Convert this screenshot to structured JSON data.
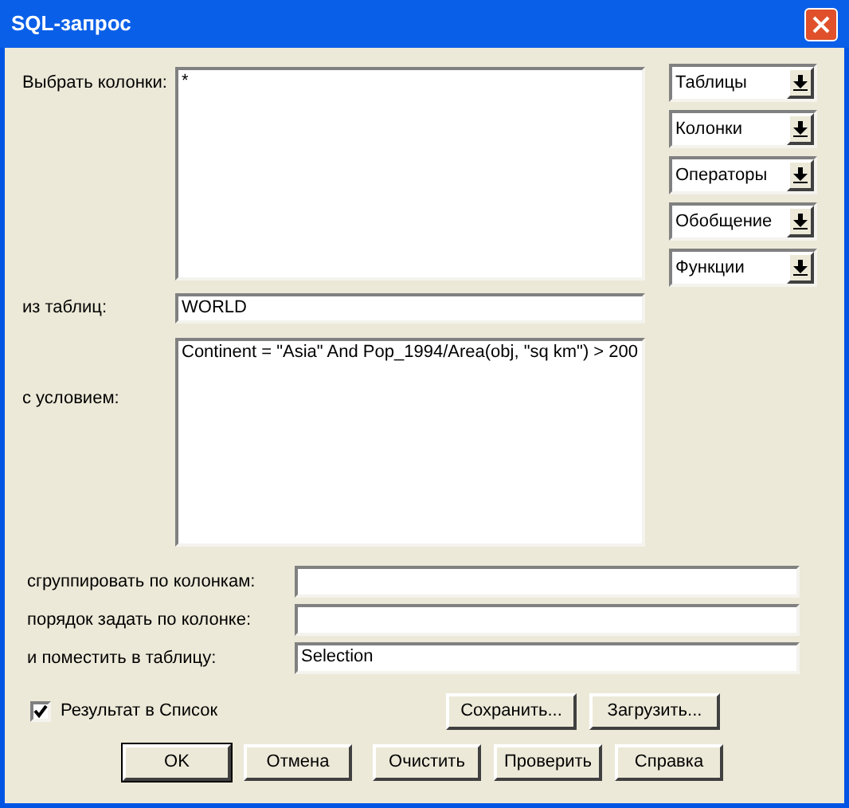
{
  "window": {
    "title": "SQL-запрос"
  },
  "select_columns": {
    "label": "Выбрать колонки:",
    "value": "*"
  },
  "dropdowns": [
    {
      "label": "Таблицы"
    },
    {
      "label": "Колонки"
    },
    {
      "label": "Операторы"
    },
    {
      "label": "Обобщение"
    },
    {
      "label": "Функции"
    }
  ],
  "from_tables": {
    "label": "из таблиц:",
    "value": "WORLD"
  },
  "condition": {
    "label": "с условием:",
    "value": "Continent = \"Asia\" And Pop_1994/Area(obj, \"sq km\") > 200"
  },
  "lower_fields": [
    {
      "label": "сгруппировать по колонкам:"
    },
    {
      "label": "порядок задать по колонке:"
    },
    {
      "label": "и поместить в таблицу:",
      "value": "Selection"
    }
  ],
  "result_to_list": {
    "label": "Результат в Список",
    "checked": true
  },
  "file_buttons": [
    {
      "label": "Сохранить..."
    },
    {
      "label": "Загрузить..."
    }
  ],
  "dialog_buttons": [
    {
      "label": "OK",
      "default": true
    },
    {
      "label": "Отмена",
      "default": false
    },
    {
      "label": "Очистить",
      "default": false
    },
    {
      "label": "Проверить",
      "default": false
    },
    {
      "label": "Справка",
      "default": false
    }
  ]
}
